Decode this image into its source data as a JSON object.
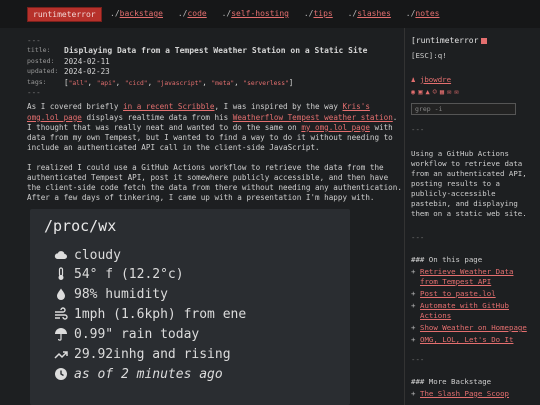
{
  "site": {
    "brand": "runtimeterror"
  },
  "nav": [
    {
      "prefix": "./",
      "name": "backstage"
    },
    {
      "prefix": "./",
      "name": "code"
    },
    {
      "prefix": "./",
      "name": "self-hosting"
    },
    {
      "prefix": "./",
      "name": "tips"
    },
    {
      "prefix": "./",
      "name": "slashes"
    },
    {
      "prefix": "./",
      "name": "notes"
    }
  ],
  "meta": {
    "rule": "---",
    "title_label": "title:",
    "title": "Displaying Data from a Tempest Weather Station on a Static Site",
    "posted_label": "posted:",
    "posted": "2024-02-11",
    "updated_label": "updated:",
    "updated": "2024-02-23",
    "tags_label": "tags:",
    "tags": [
      "\"all\"",
      "\"api\"",
      "\"cicd\"",
      "\"javascript\"",
      "\"meta\"",
      "\"serverless\""
    ],
    "rule_end": "---"
  },
  "body": {
    "p1": {
      "t1": "As I covered briefly ",
      "l1": "in a recent Scribble",
      "t2": ", I was inspired by the way ",
      "l2": "Kris's omg.lol page",
      "t3": " displays realtime data from his ",
      "l3": "Weatherflow Tempest weather station",
      "t4": ". I thought that was really neat and wanted to do the same on ",
      "l4": "my omg.lol page",
      "t5": " with data from my own Tempest, but I wanted to find a way to do it without needing to include an authenticated API call in the client-side JavaScript."
    },
    "p2": "I realized I could use a GitHub Actions workflow to retrieve the data from the authenticated Tempest API, post it somewhere publicly accessible, and then have the client-side code fetch the data from there without needing any authentication. After a few days of tinkering, I came up with a presentation I'm happy with."
  },
  "weather": {
    "title": "/proc/wx",
    "rows": [
      {
        "icon": "cloud-icon",
        "text": "cloudy"
      },
      {
        "icon": "thermometer-icon",
        "text": "54° f (12.2°c)"
      },
      {
        "icon": "droplet-icon",
        "text": "98% humidity"
      },
      {
        "icon": "wind-icon",
        "text": "1mph (1.6kph) from ene"
      },
      {
        "icon": "umbrella-icon",
        "text": "0.99\" rain today"
      },
      {
        "icon": "trend-up-icon",
        "text": "29.92inhg and rising"
      },
      {
        "icon": "clock-icon",
        "text": "as of 2 minutes ago"
      }
    ]
  },
  "sidebar": {
    "site_name": "[runtimeterror",
    "shell": "[ESC]:q!",
    "author": "jbowdre",
    "search_placeholder": "grep -i",
    "rule1": "---",
    "blurb": "Using a GitHub Actions workflow to retrieve data from an authenticated API, posting results to a publicly-accessible pastebin, and displaying them on a static web site.",
    "rule2": "---",
    "on_this_page_title": "### On this page",
    "toc": [
      "Retrieve Weather Data from Tempest API",
      "Post to paste.lol",
      "Automate with GitHub Actions",
      "Show Weather on Homepage",
      "OMG, LOL, Let's Do It"
    ],
    "rule3": "---",
    "more_title": "### More Backstage",
    "more": [
      "The Slash Page Scoop"
    ]
  },
  "colors": {
    "accent": "#e46f6f",
    "brand_bg": "#b7312b",
    "page_bg": "#1d1f21",
    "widget_bg": "#2a2d31"
  }
}
